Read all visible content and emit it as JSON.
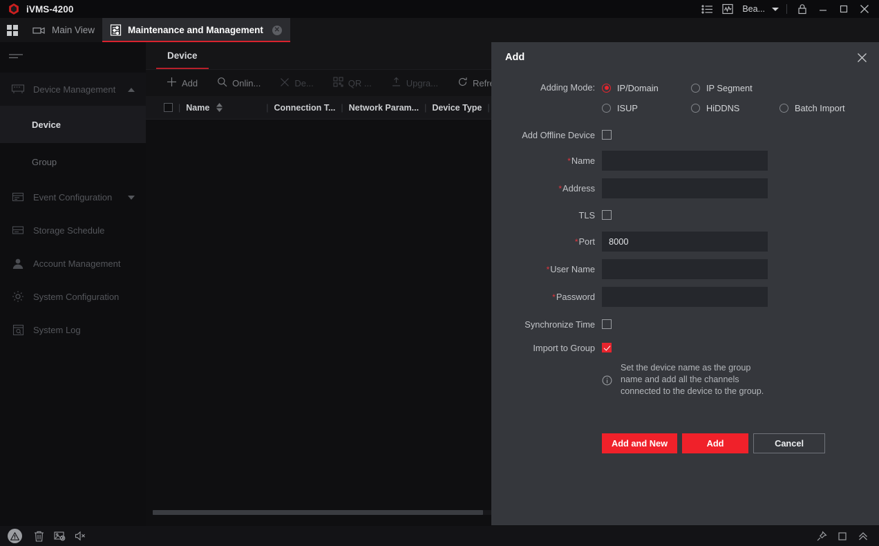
{
  "app": {
    "title": "iVMS-4200",
    "logo_color": "#cc1f1f",
    "accent_color": "#e8252e"
  },
  "titlebar": {
    "icons": [
      "list-icon",
      "activity-chart-icon"
    ],
    "user_label": "Bea...",
    "lock_label": "lock-icon",
    "minimize_label": "minimize-icon",
    "maximize_label": "maximize-icon",
    "close_label": "close-icon"
  },
  "tabs": [
    {
      "label": "Main View",
      "icon": "camera-icon",
      "active": false,
      "closable": false
    },
    {
      "label": "Maintenance and Management",
      "icon": "maintenance-icon",
      "active": true,
      "closable": true
    }
  ],
  "sidebar": {
    "items": [
      {
        "label": "Device Management",
        "icon": "device-icon",
        "expanded": true,
        "arrow": "chevron-up-icon"
      },
      {
        "label": "Device",
        "sub": true,
        "active": true
      },
      {
        "label": "Group",
        "sub": true,
        "active": false
      },
      {
        "label": "Event Configuration",
        "icon": "event-icon",
        "expanded": false,
        "arrow": "chevron-down-icon"
      },
      {
        "label": "Storage Schedule",
        "icon": "storage-icon"
      },
      {
        "label": "Account Management",
        "icon": "account-icon"
      },
      {
        "label": "System Configuration",
        "icon": "gear-icon"
      },
      {
        "label": "System Log",
        "icon": "log-icon"
      }
    ]
  },
  "content": {
    "tab_label": "Device",
    "toolbar": [
      {
        "label": "Add",
        "icon": "plus-icon",
        "enabled": true
      },
      {
        "label": "Onlin...",
        "icon": "search-icon",
        "enabled": true
      },
      {
        "label": "De...",
        "icon": "close-x-icon",
        "enabled": false
      },
      {
        "label": "QR ...",
        "icon": "qrcode-icon",
        "enabled": false
      },
      {
        "label": "Upgra...",
        "icon": "upload-icon",
        "enabled": false
      },
      {
        "label": "Refres",
        "icon": "refresh-icon",
        "enabled": true
      }
    ],
    "table_headers": [
      "Name",
      "Connection T...",
      "Network Param...",
      "Device Type"
    ]
  },
  "dialog": {
    "title": "Add",
    "close_icon": "close-icon",
    "adding_mode_label": "Adding Mode:",
    "adding_modes": [
      {
        "label": "IP/Domain",
        "selected": true
      },
      {
        "label": "IP Segment",
        "selected": false
      },
      {
        "label": "ISUP",
        "selected": false
      },
      {
        "label": "HiDDNS",
        "selected": false
      },
      {
        "label": "Batch Import",
        "selected": false
      }
    ],
    "fields": {
      "add_offline_device": {
        "label": "Add Offline Device",
        "checked": false
      },
      "name": {
        "label": "Name",
        "required": true,
        "value": "",
        "placeholder": ""
      },
      "address": {
        "label": "Address",
        "required": true,
        "value": "",
        "placeholder": ""
      },
      "tls": {
        "label": "TLS",
        "checked": false
      },
      "port": {
        "label": "Port",
        "required": true,
        "value": "8000",
        "placeholder": ""
      },
      "user_name": {
        "label": "User Name",
        "required": true,
        "value": "",
        "placeholder": ""
      },
      "password": {
        "label": "Password",
        "required": true,
        "value": "",
        "placeholder": ""
      },
      "synchronize_time": {
        "label": "Synchronize Time",
        "checked": false
      },
      "import_to_group": {
        "label": "Import to Group",
        "checked": true
      }
    },
    "note": "Set the device name as the group name and add all the channels connected to the device to the group.",
    "note_icon": "info-icon",
    "buttons": [
      {
        "label": "Add and New",
        "style": "primary"
      },
      {
        "label": "Add",
        "style": "primary"
      },
      {
        "label": "Cancel",
        "style": "ghost"
      }
    ]
  },
  "statusbar": {
    "left_icons": [
      "alert-warning-icon",
      "trash-icon",
      "picture-disabled-icon",
      "mute-icon"
    ],
    "right_icons": [
      "pin-icon",
      "square-icon",
      "chevron-double-up-icon"
    ]
  }
}
